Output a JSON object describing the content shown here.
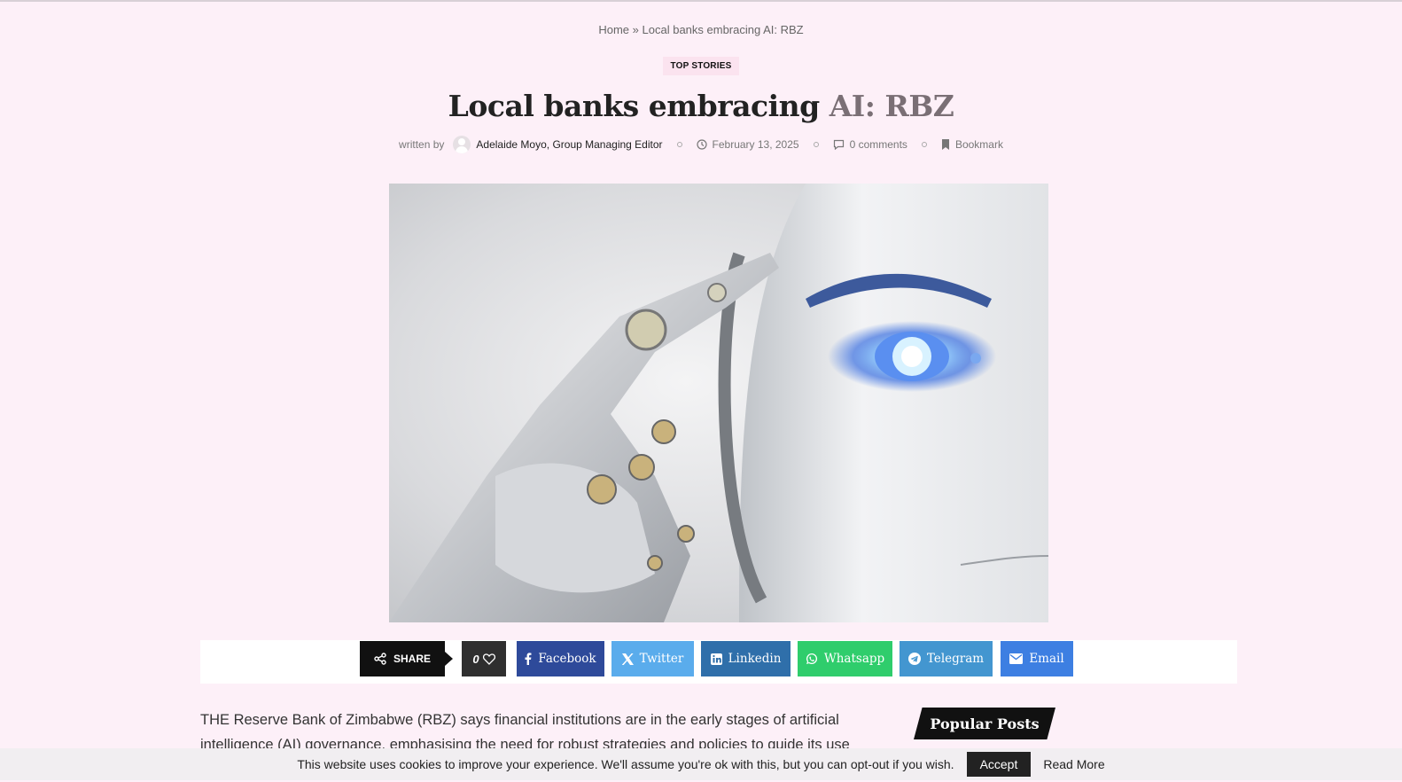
{
  "breadcrumb": {
    "home": "Home",
    "separator": "»",
    "current": "Local banks embracing AI: RBZ"
  },
  "category": "TOP STORIES",
  "article": {
    "title_main": "Local banks embracing ",
    "title_fade": "AI: RBZ",
    "written_by": "written by",
    "author": "Adelaide Moyo, Group Managing Editor",
    "date": "February 13, 2025",
    "comments": "0 comments",
    "bookmark": "Bookmark",
    "body": "THE Reserve Bank of Zimbabwe (RBZ) says financial institutions are in the early stages of artificial intelligence (AI) governance, emphasising the need for robust strategies and policies to guide its use in"
  },
  "share": {
    "label": "SHARE",
    "likes": "0",
    "buttons": [
      {
        "label": "Facebook",
        "color": "#2e4a9a"
      },
      {
        "label": "Twitter",
        "color": "#5aacec"
      },
      {
        "label": "Linkedin",
        "color": "#2f6faa"
      },
      {
        "label": "Whatsapp",
        "color": "#2fcd6c"
      },
      {
        "label": "Telegram",
        "color": "#4396d0"
      },
      {
        "label": "Email",
        "color": "#3d7fe2"
      }
    ]
  },
  "sidebar": {
    "popular_title": "Popular Posts"
  },
  "cookie": {
    "message": "This website uses cookies to improve your experience. We'll assume you're ok with this, but you can opt-out if you wish.",
    "accept": "Accept",
    "read_more": "Read More"
  },
  "icons": {
    "share": "share-icon",
    "heart": "heart-icon",
    "facebook": "facebook-icon",
    "x": "x-icon",
    "linkedin": "linkedin-icon",
    "whatsapp": "whatsapp-icon",
    "telegram": "telegram-icon",
    "email": "email-icon",
    "clock": "clock-icon",
    "comment": "comment-icon",
    "bookmark": "bookmark-icon"
  }
}
